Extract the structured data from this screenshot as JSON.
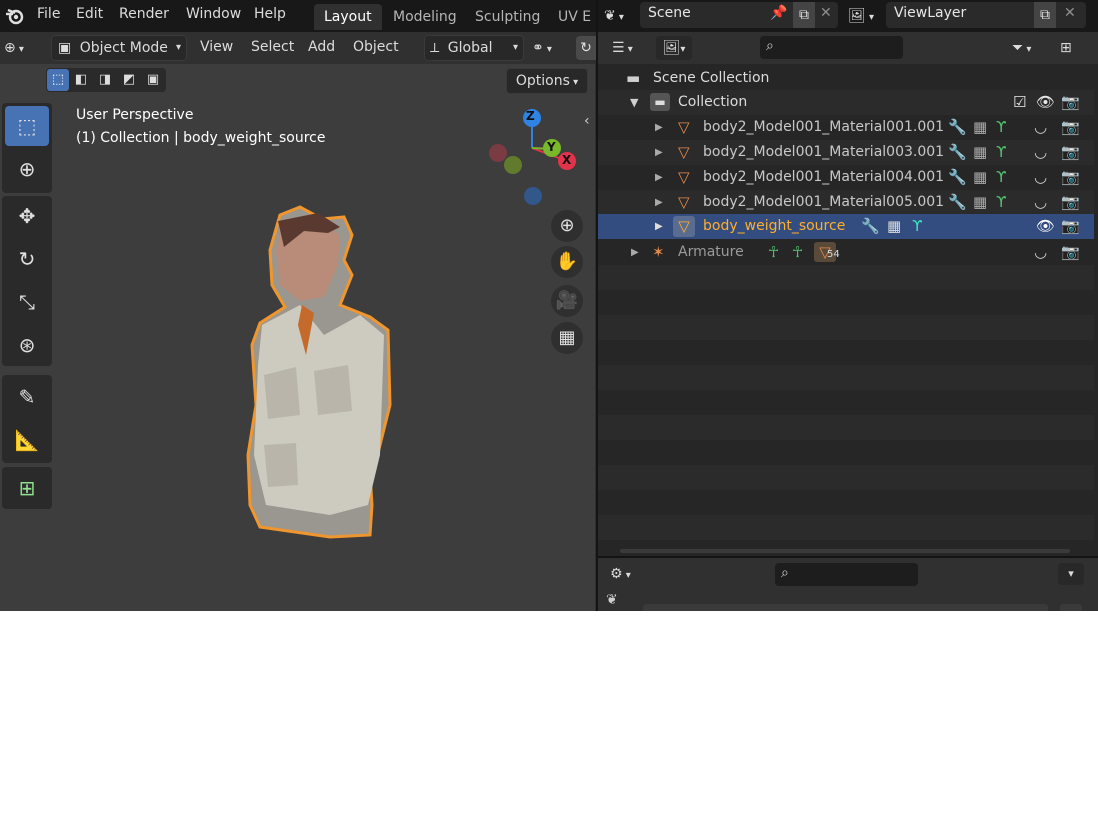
{
  "menu": {
    "logo": "blender-logo",
    "items": [
      "File",
      "Edit",
      "Render",
      "Window",
      "Help"
    ]
  },
  "workspaces": [
    "Layout",
    "Modeling",
    "Sculpting",
    "UV E"
  ],
  "scene": {
    "name": "Scene"
  },
  "view_layer": {
    "name": "ViewLayer"
  },
  "viewport_header": {
    "mode": "Object Mode",
    "menus": [
      "View",
      "Select",
      "Add",
      "Object"
    ],
    "orientation": "Global",
    "options": "Options"
  },
  "viewport_overlay": {
    "line1": "User Perspective",
    "line2": "(1) Collection | body_weight_source"
  },
  "gizmo": {
    "x": "X",
    "y": "Y",
    "z": "Z"
  },
  "outliner": {
    "scene_collection": "Scene Collection",
    "collection": "Collection",
    "objects": [
      {
        "name": "body2_Model001_Material001.001"
      },
      {
        "name": "body2_Model001_Material003.001"
      },
      {
        "name": "body2_Model001_Material004.001"
      },
      {
        "name": "body2_Model001_Material005.001"
      },
      {
        "name": "body_weight_source"
      }
    ],
    "armature": {
      "name": "Armature",
      "badge": "54"
    }
  },
  "colors": {
    "accent": "#4772b3",
    "selected_object": "#ffaf29",
    "selection_row": "#334d80",
    "mesh_icon": "#e18a4c",
    "axis_x": "#e2334a",
    "axis_y": "#79b82a",
    "axis_z": "#2f84e3"
  }
}
